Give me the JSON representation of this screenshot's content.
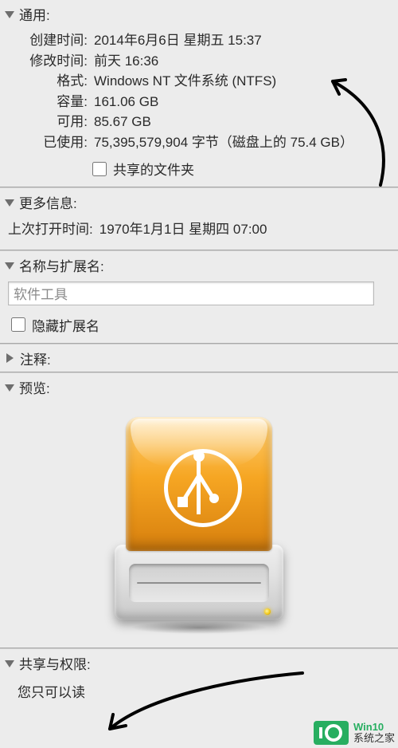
{
  "sections": {
    "general": {
      "title": "通用:"
    },
    "moreinfo": {
      "title": "更多信息:"
    },
    "nameext": {
      "title": "名称与扩展名:"
    },
    "comments": {
      "title": "注释:"
    },
    "preview": {
      "title": "预览:"
    },
    "sharing": {
      "title": "共享与权限:"
    }
  },
  "general": {
    "created_label": "创建时间:",
    "created_value": "2014年6月6日 星期五 15:37",
    "modified_label": "修改时间:",
    "modified_value": "前天 16:36",
    "format_label": "格式:",
    "format_value": "Windows NT 文件系统 (NTFS)",
    "capacity_label": "容量:",
    "capacity_value": "161.06 GB",
    "available_label": "可用:",
    "available_value": "85.67 GB",
    "used_label": "已使用:",
    "used_value": "75,395,579,904 字节（磁盘上的 75.4 GB）",
    "shared_folder_label": "共享的文件夹"
  },
  "moreinfo": {
    "last_opened_label": "上次打开时间:",
    "last_opened_value": "1970年1月1日 星期四 07:00"
  },
  "nameext": {
    "name_value": "软件工具",
    "hide_ext_label": "隐藏扩展名"
  },
  "sharing": {
    "permission_text": "您只可以读"
  },
  "watermark": {
    "line1": "Win10",
    "line2": "系统之家"
  }
}
